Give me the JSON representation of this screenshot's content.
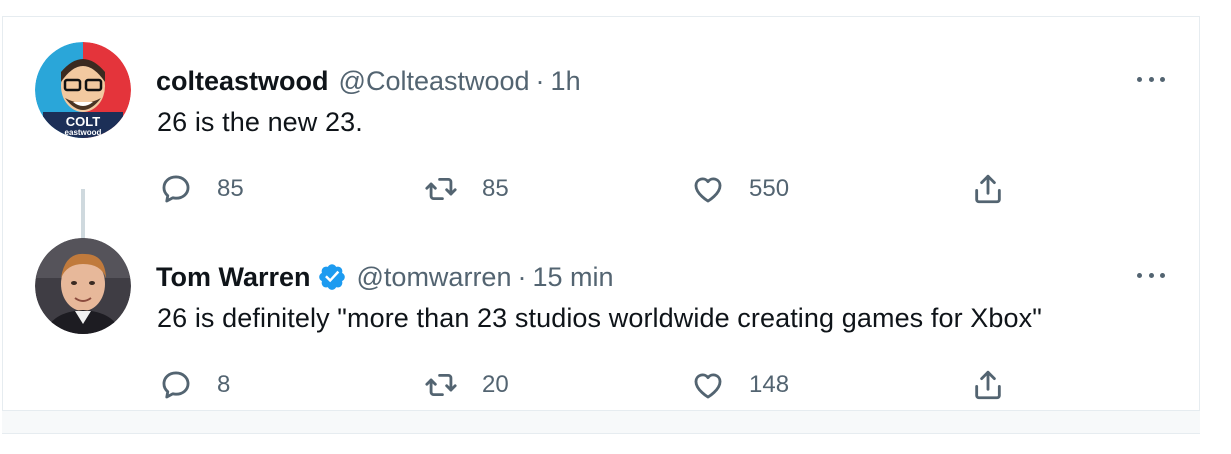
{
  "thread": [
    {
      "display_name": "colteastwood",
      "handle": "@Colteastwood",
      "separator": "·",
      "time": "1h",
      "verified": false,
      "text": "26 is the new 23.",
      "avatar": {
        "icon": "colt-eastwood-logo-avatar",
        "logo_text": "COLT",
        "logo_subtext": "eastwood"
      },
      "stats": {
        "replies": "85",
        "retweets": "85",
        "likes": "550"
      }
    },
    {
      "display_name": "Tom Warren",
      "handle": "@tomwarren",
      "separator": "·",
      "time": "15 min",
      "verified": true,
      "text": "26 is definitely \"more than 23 studios worldwide creating games for Xbox\"",
      "avatar": {
        "icon": "user-photo-avatar"
      },
      "stats": {
        "replies": "8",
        "retweets": "20",
        "likes": "148"
      }
    }
  ],
  "icons": {
    "reply": "reply-icon",
    "retweet": "retweet-icon",
    "like": "heart-icon",
    "share": "share-icon",
    "more": "more-dots-icon",
    "verified": "verified-badge-icon"
  },
  "colors": {
    "text_primary": "#0f1419",
    "text_secondary": "#536471",
    "verified_blue": "#1d9bf0",
    "border": "#e6ecf0",
    "thread_line": "#cfd9de"
  }
}
